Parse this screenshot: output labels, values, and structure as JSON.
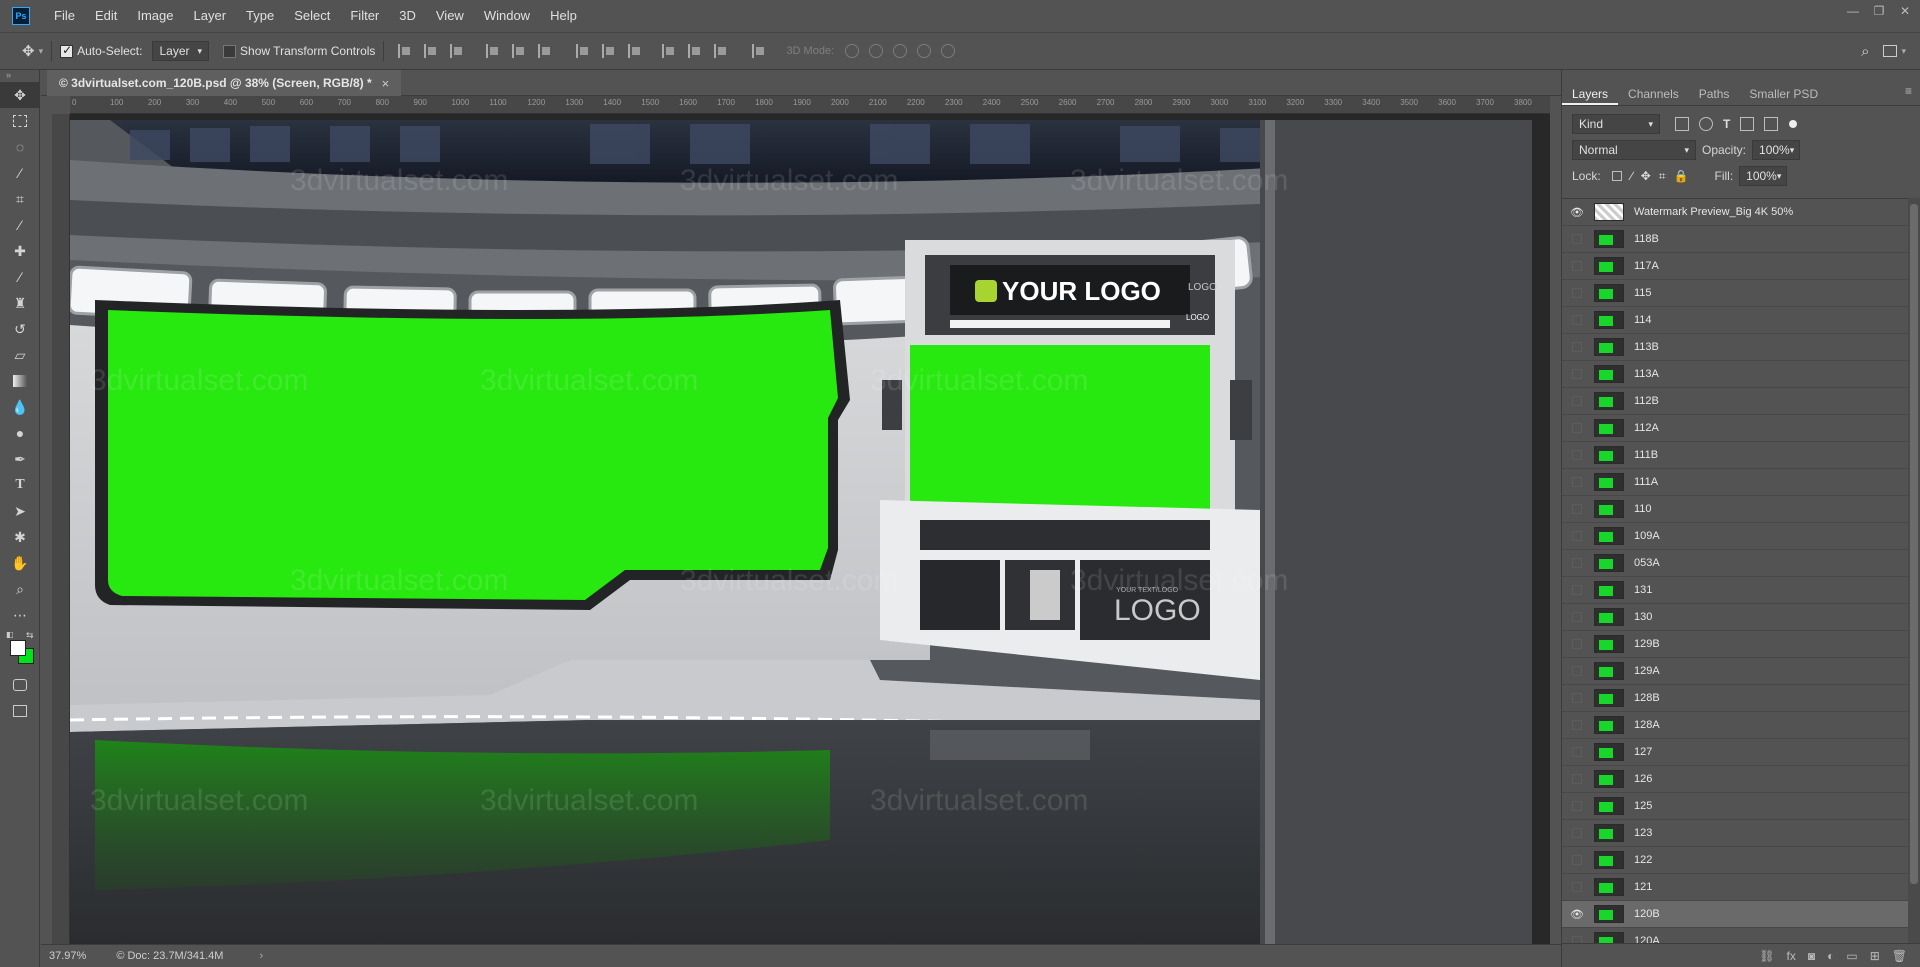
{
  "app": {
    "logo": "Ps",
    "title_menus": [
      "File",
      "Edit",
      "Image",
      "Layer",
      "Type",
      "Select",
      "Filter",
      "3D",
      "View",
      "Window",
      "Help"
    ]
  },
  "window_controls": {
    "minimize": "—",
    "restore": "❐",
    "close": "✕"
  },
  "options": {
    "auto_select_label": "Auto-Select:",
    "auto_select_target": "Layer",
    "show_transform_label": "Show Transform Controls",
    "mode3d_label": "3D Mode:"
  },
  "document": {
    "tab_title": "© 3dvirtualset.com_120B.psd @ 38% (Screen, RGB/8) *",
    "close": "×",
    "zoom": "37.97%",
    "doc_size": "© Doc: 23.7M/341.4M",
    "ruler_ticks": [
      "0",
      "100",
      "200",
      "300",
      "400",
      "500",
      "600",
      "700",
      "800",
      "900",
      "1000",
      "1100",
      "1200",
      "1300",
      "1400",
      "1500",
      "1600",
      "1700",
      "1800",
      "1900",
      "2000",
      "2100",
      "2200",
      "2300",
      "2400",
      "2500",
      "2600",
      "2700",
      "2800",
      "2900",
      "3000",
      "3100",
      "3200",
      "3300",
      "3400",
      "3500",
      "3600",
      "3700",
      "3800"
    ]
  },
  "canvas_image": {
    "logo_text": "YOUR LOGO",
    "logo_small": "LOGO",
    "logo_small2": "LOGO",
    "logo_desk": "LOGO",
    "logo_desk_sub": "YOUR TEXT/LOGO",
    "watermark": "3dvirtualset.com"
  },
  "panels": {
    "tabs": [
      "Layers",
      "Channels",
      "Paths",
      "Smaller PSD"
    ],
    "kind_label": "Kind",
    "blend_mode": "Normal",
    "opacity_label": "Opacity:",
    "opacity_value": "100%",
    "lock_label": "Lock:",
    "fill_label": "Fill:",
    "fill_value": "100%",
    "layers": [
      {
        "name": "Watermark Preview_Big 4K 50%",
        "visible": true,
        "checker": true
      },
      {
        "name": "118B",
        "visible": false
      },
      {
        "name": "117A",
        "visible": false
      },
      {
        "name": "115",
        "visible": false
      },
      {
        "name": "114",
        "visible": false
      },
      {
        "name": "113B",
        "visible": false
      },
      {
        "name": "113A",
        "visible": false
      },
      {
        "name": "112B",
        "visible": false
      },
      {
        "name": "112A",
        "visible": false
      },
      {
        "name": "111B",
        "visible": false
      },
      {
        "name": "111A",
        "visible": false
      },
      {
        "name": "110",
        "visible": false
      },
      {
        "name": "109A",
        "visible": false
      },
      {
        "name": "053A",
        "visible": false
      },
      {
        "name": "131",
        "visible": false
      },
      {
        "name": "130",
        "visible": false
      },
      {
        "name": "129B",
        "visible": false
      },
      {
        "name": "129A",
        "visible": false
      },
      {
        "name": "128B",
        "visible": false
      },
      {
        "name": "128A",
        "visible": false
      },
      {
        "name": "127",
        "visible": false
      },
      {
        "name": "126",
        "visible": false
      },
      {
        "name": "125",
        "visible": false
      },
      {
        "name": "123",
        "visible": false
      },
      {
        "name": "122",
        "visible": false
      },
      {
        "name": "121",
        "visible": false
      },
      {
        "name": "120B",
        "visible": true,
        "selected": true
      },
      {
        "name": "120A",
        "visible": false
      }
    ],
    "footer_icons": [
      "link-icon",
      "fx-icon",
      "mask-icon",
      "adjustment-icon",
      "group-icon",
      "new-layer-icon",
      "trash-icon"
    ]
  },
  "colors": {
    "foreground": "#ffffff",
    "background": "#00e31a",
    "green_screen": "#27e80f"
  }
}
